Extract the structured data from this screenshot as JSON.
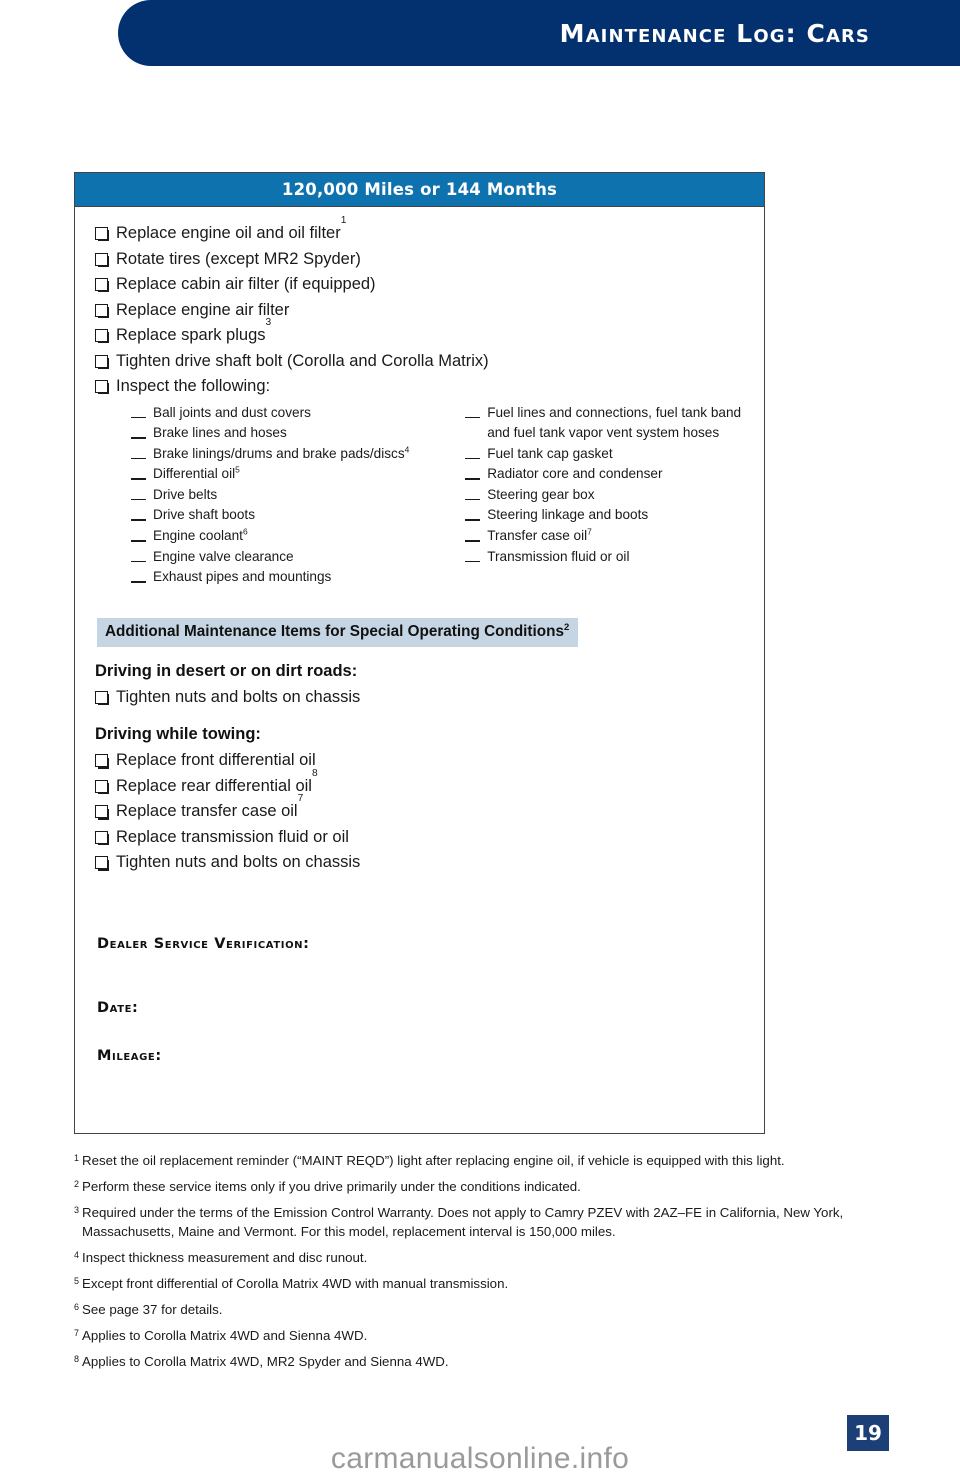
{
  "header": {
    "title": "Maintenance Log: Cars"
  },
  "log": {
    "title_bar": "120,000 Miles or 144 Months",
    "checklist": [
      {
        "label": "Replace engine oil and oil filter",
        "sup": "1"
      },
      {
        "label": "Rotate tires (except MR2 Spyder)",
        "sup": ""
      },
      {
        "label": "Replace cabin air filter (if equipped)",
        "sup": ""
      },
      {
        "label": "Replace engine air filter",
        "sup": ""
      },
      {
        "label": "Replace spark plugs",
        "sup": "3"
      },
      {
        "label": "Tighten drive shaft bolt (Corolla and Corolla Matrix)",
        "sup": ""
      },
      {
        "label": "Inspect the following:",
        "sup": ""
      }
    ],
    "inspect_left": [
      {
        "label": "Ball joints and dust covers",
        "sup": ""
      },
      {
        "label": "Brake lines and hoses",
        "sup": ""
      },
      {
        "label": "Brake linings/drums and brake pads/discs",
        "sup": "4"
      },
      {
        "label": "Differential oil",
        "sup": "5"
      },
      {
        "label": "Drive belts",
        "sup": ""
      },
      {
        "label": "Drive shaft boots",
        "sup": ""
      },
      {
        "label": "Engine coolant",
        "sup": "6"
      },
      {
        "label": "Engine valve clearance",
        "sup": ""
      },
      {
        "label": "Exhaust pipes and mountings",
        "sup": ""
      }
    ],
    "inspect_right": [
      {
        "label": "Fuel lines and connections, fuel tank band and fuel tank vapor vent system hoses",
        "sup": ""
      },
      {
        "label": "Fuel tank cap gasket",
        "sup": ""
      },
      {
        "label": "Radiator core and condenser",
        "sup": ""
      },
      {
        "label": "Steering gear box",
        "sup": ""
      },
      {
        "label": "Steering linkage and boots",
        "sup": ""
      },
      {
        "label": "Transfer case oil",
        "sup": "7"
      },
      {
        "label": "Transmission fluid or oil",
        "sup": ""
      }
    ],
    "additional_band": "Additional Maintenance Items for Special Operating Conditions",
    "additional_band_sup": "2",
    "desert_heading": "Driving in desert or on dirt roads:",
    "desert_items": [
      {
        "label": "Tighten nuts and bolts on chassis",
        "sup": ""
      }
    ],
    "towing_heading": "Driving while towing:",
    "towing_items": [
      {
        "label": "Replace front differential oil",
        "sup": ""
      },
      {
        "label": "Replace rear differential oil",
        "sup": "8"
      },
      {
        "label": "Replace transfer case oil",
        "sup": "7"
      },
      {
        "label": "Replace transmission fluid or oil",
        "sup": ""
      },
      {
        "label": "Tighten nuts and bolts on chassis",
        "sup": ""
      }
    ],
    "verification_label": "Dealer Service Verification:",
    "date_label": "Date:",
    "mileage_label": "Mileage:"
  },
  "footnotes": [
    {
      "num": "1",
      "text": "Reset the oil replacement reminder (“MAINT REQD”) light after replacing engine oil, if vehicle is equipped with this light."
    },
    {
      "num": "2",
      "text": "Perform these service items only if you drive primarily under the conditions indicated."
    },
    {
      "num": "3",
      "text": "Required under the terms of the Emission Control Warranty. Does not apply to Camry PZEV with 2AZ–FE in California, New York, Massachusetts, Maine and Vermont. For this model, replacement interval is 150,000 miles."
    },
    {
      "num": "4",
      "text": "Inspect thickness measurement and disc runout."
    },
    {
      "num": "5",
      "text": "Except front differential of Corolla Matrix 4WD with manual transmission."
    },
    {
      "num": "6",
      "text": "See page 37 for details."
    },
    {
      "num": "7",
      "text": "Applies to Corolla Matrix 4WD and Sienna 4WD."
    },
    {
      "num": "8",
      "text": "Applies to Corolla Matrix 4WD, MR2 Spyder and Sienna 4WD."
    }
  ],
  "page_number": "19",
  "watermark": "carmanualsonline.info",
  "colors": {
    "header_navy": "#03306e",
    "title_bar_blue": "#0e72ae",
    "band_blue": "#c5d5e4",
    "badge_navy": "#1c3f77"
  }
}
